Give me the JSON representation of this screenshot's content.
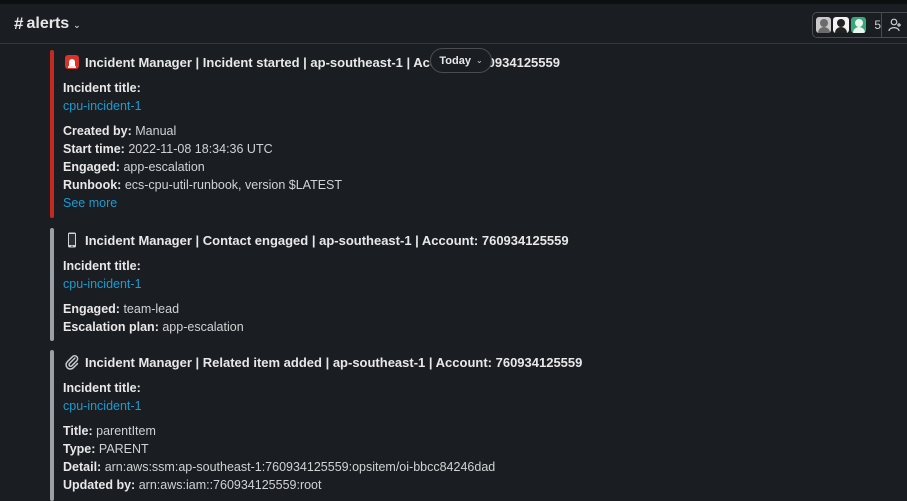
{
  "channel": {
    "hash": "#",
    "name": "alerts"
  },
  "members": {
    "count": "5"
  },
  "today_label": "Today",
  "messages": [
    {
      "bar_color": "#c42a22",
      "title": "Incident Manager | Incident started | ap-southeast-1 | Account: 760934125559",
      "incident_label": "Incident title:",
      "incident_link": "cpu-incident-1",
      "fields": [
        {
          "label": "Created by:",
          "value": "Manual"
        },
        {
          "label": "Start time:",
          "value": "2022-11-08 18:34:36 UTC"
        },
        {
          "label": "Engaged:",
          "value": "app-escalation"
        },
        {
          "label": "Runbook:",
          "value": "ecs-cpu-util-runbook, version $LATEST"
        }
      ],
      "see_more": "See more"
    },
    {
      "bar_color": "#9aa0a6",
      "title": "Incident Manager | Contact engaged | ap-southeast-1 | Account: 760934125559",
      "incident_label": "Incident title:",
      "incident_link": "cpu-incident-1",
      "fields": [
        {
          "label": "Engaged:",
          "value": "team-lead"
        },
        {
          "label": "Escalation plan:",
          "value": "app-escalation"
        }
      ]
    },
    {
      "bar_color": "#9aa0a6",
      "title": "Incident Manager | Related item added | ap-southeast-1 | Account: 760934125559",
      "incident_label": "Incident title:",
      "incident_link": "cpu-incident-1",
      "fields": [
        {
          "label": "Title:",
          "value": "parentItem"
        },
        {
          "label": "Type:",
          "value": "PARENT"
        },
        {
          "label": "Detail:",
          "value": "arn:aws:ssm:ap-southeast-1:760934125559:opsitem/oi-bbcc84246dad"
        },
        {
          "label": "Updated by:",
          "value": "arn:aws:iam::760934125559:root"
        }
      ]
    }
  ]
}
